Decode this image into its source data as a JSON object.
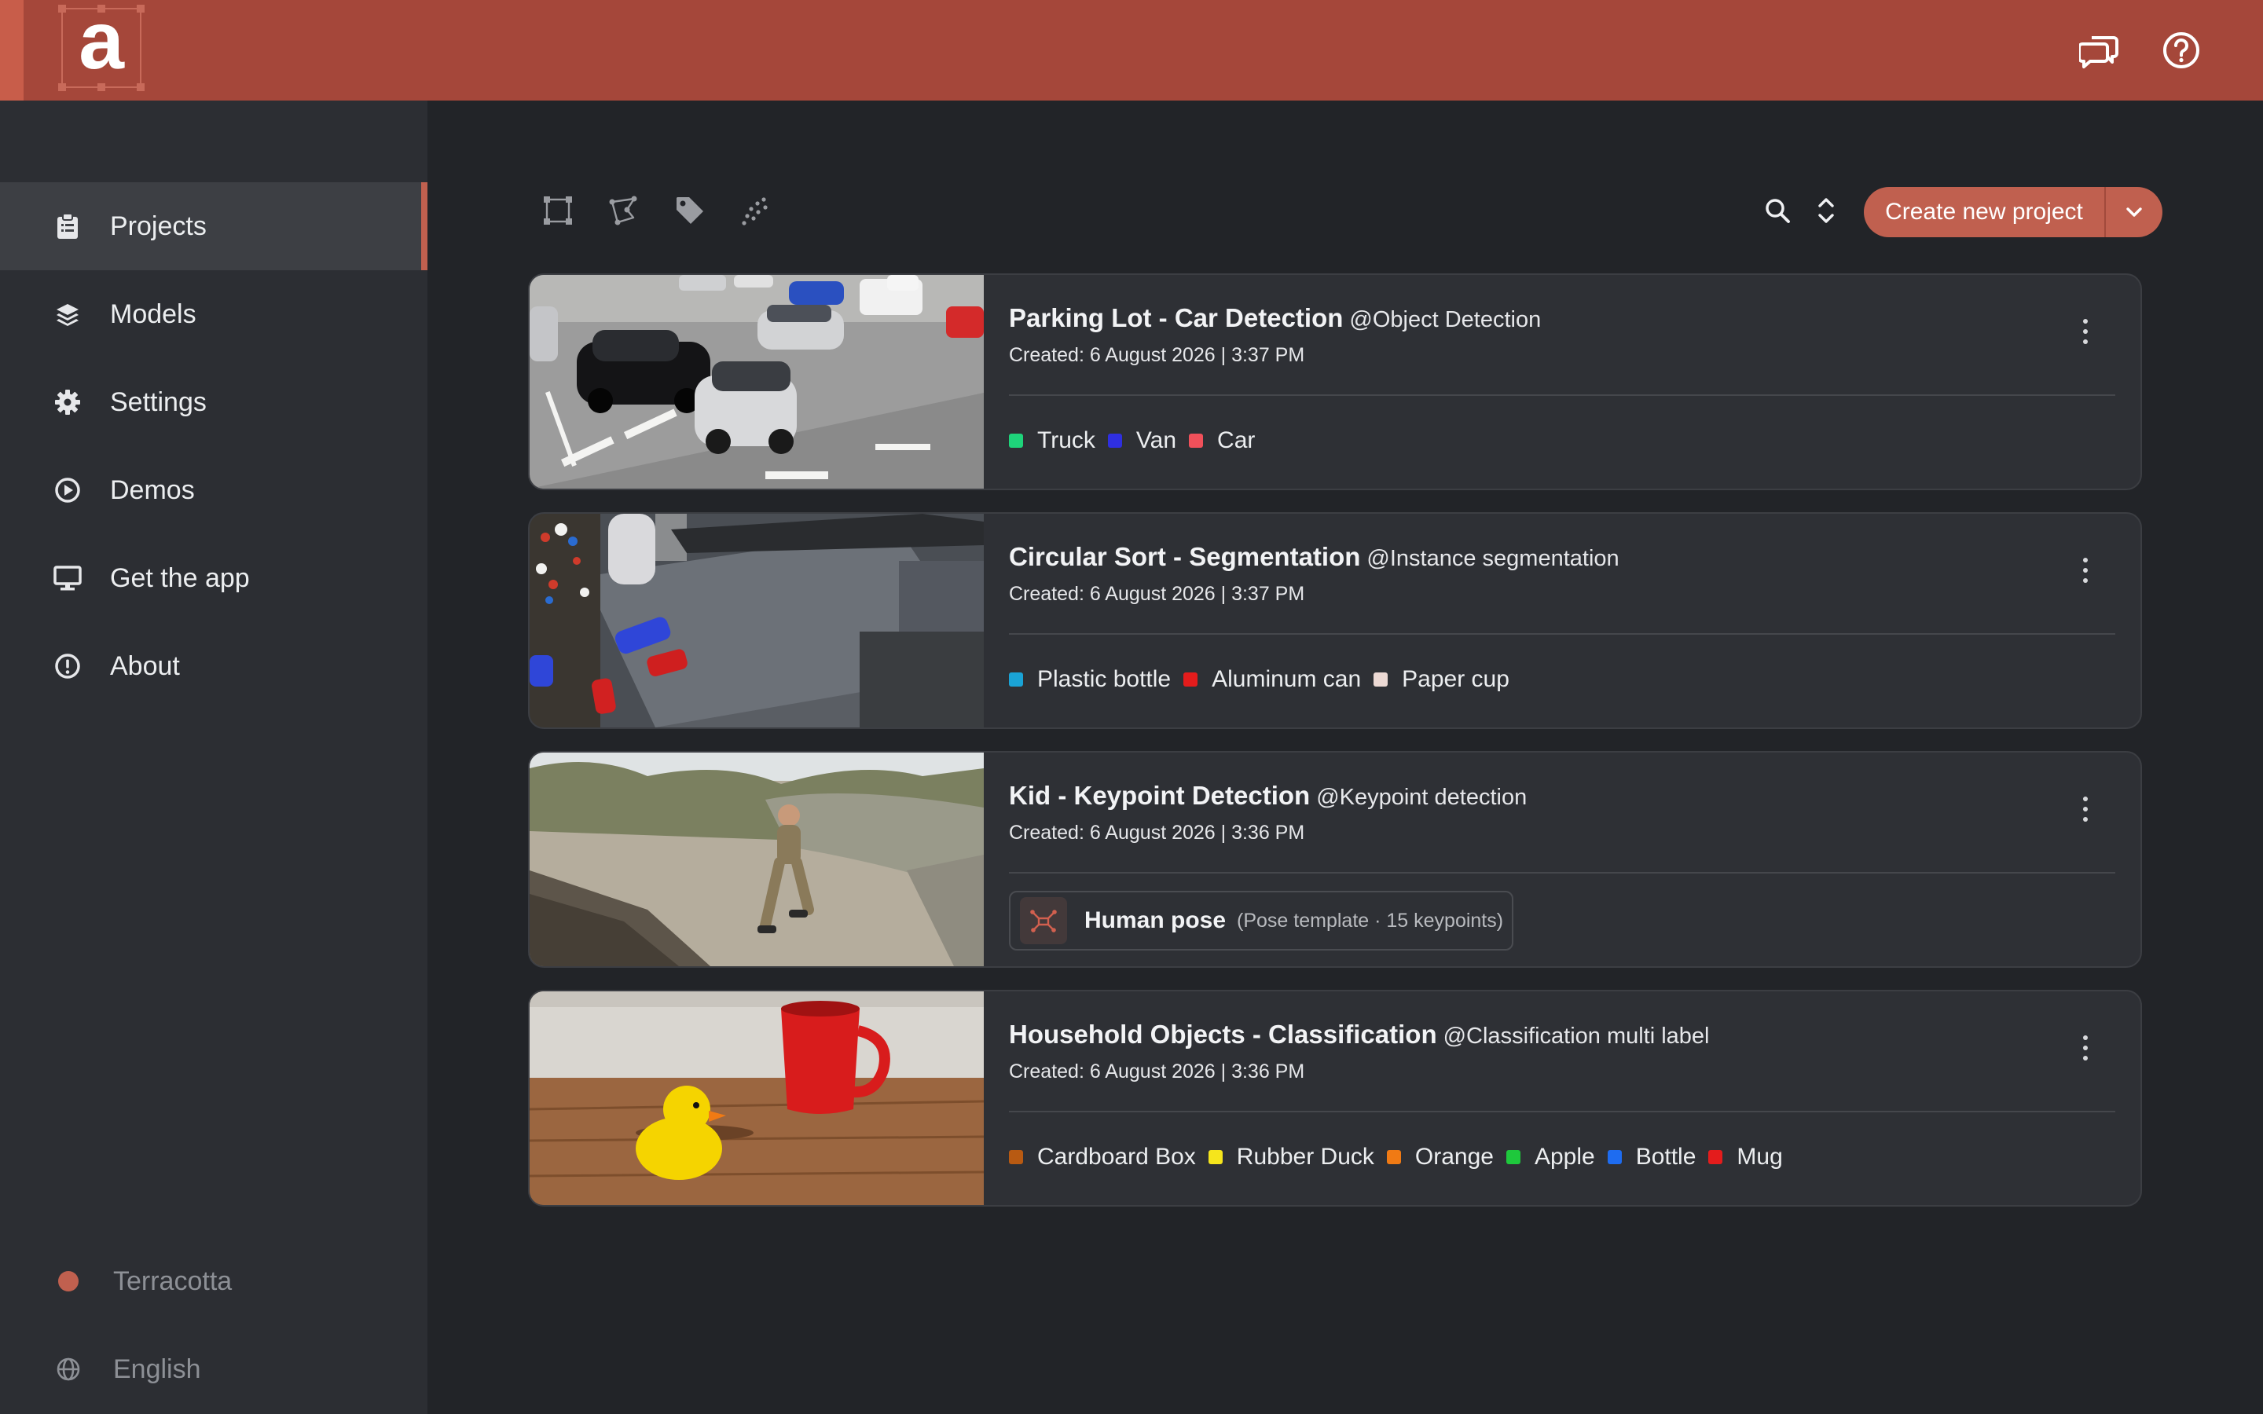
{
  "brand": {
    "logo_letter": "a",
    "accent": "#c0604f",
    "topbar_color": "#a5473a"
  },
  "topbar": {
    "icons": [
      "chat-icon",
      "help-icon"
    ]
  },
  "sidebar": {
    "items": [
      {
        "label": "Projects",
        "icon": "clipboard-icon",
        "active": true
      },
      {
        "label": "Models",
        "icon": "layers-icon",
        "active": false
      },
      {
        "label": "Settings",
        "icon": "gear-icon",
        "active": false
      },
      {
        "label": "Demos",
        "icon": "play-circle-icon",
        "active": false
      },
      {
        "label": "Get the app",
        "icon": "monitor-icon",
        "active": false
      },
      {
        "label": "About",
        "icon": "info-circle-icon",
        "active": false
      }
    ],
    "theme": {
      "label": "Terracotta",
      "color": "#c0604f"
    },
    "language": {
      "label": "English",
      "icon": "globe-icon"
    }
  },
  "toolbar": {
    "filters": [
      "bounding-box-icon",
      "polygon-icon",
      "tag-icon",
      "keypoints-icon"
    ],
    "create_label": "Create new project"
  },
  "projects": [
    {
      "title": "Parking Lot - Car Detection",
      "task": "@Object Detection",
      "created": "Created: 6 August 2026 | 3:37 PM",
      "labels": [
        {
          "name": "Truck",
          "color": "#1ed37a"
        },
        {
          "name": "Van",
          "color": "#2f2fe0"
        },
        {
          "name": "Car",
          "color": "#f0505a"
        }
      ]
    },
    {
      "title": "Circular Sort - Segmentation",
      "task": "@Instance segmentation",
      "created": "Created: 6 August 2026 | 3:37 PM",
      "labels": [
        {
          "name": "Plastic bottle",
          "color": "#1aa3d6"
        },
        {
          "name": "Aluminum can",
          "color": "#e41c1c"
        },
        {
          "name": "Paper cup",
          "color": "#ecd9d4"
        }
      ]
    },
    {
      "title": "Kid - Keypoint Detection",
      "task": "@Keypoint detection",
      "created": "Created: 6 August 2026 | 3:36 PM",
      "pose": {
        "name": "Human pose",
        "desc": "(Pose template · 15 keypoints)"
      }
    },
    {
      "title": "Household Objects - Classification",
      "task": "@Classification multi label",
      "created": "Created: 6 August 2026 | 3:36 PM",
      "labels": [
        {
          "name": "Cardboard Box",
          "color": "#b85a12"
        },
        {
          "name": "Rubber Duck",
          "color": "#f5e51c"
        },
        {
          "name": "Orange",
          "color": "#f07a14"
        },
        {
          "name": "Apple",
          "color": "#1ec83c"
        },
        {
          "name": "Bottle",
          "color": "#1e6cf0"
        },
        {
          "name": "Mug",
          "color": "#e41c1c"
        }
      ]
    }
  ]
}
